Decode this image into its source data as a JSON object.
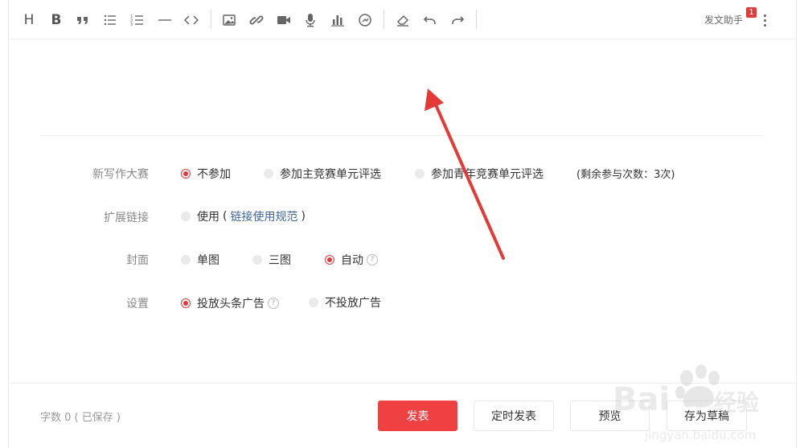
{
  "toolbar": {
    "buttons": [
      {
        "name": "heading-button",
        "text": "H"
      },
      {
        "name": "bold-button",
        "text": "B"
      },
      {
        "name": "quote-button",
        "icon": "quote-icon"
      },
      {
        "name": "bullet-list-button",
        "icon": "bullet-list-icon"
      },
      {
        "name": "numbered-list-button",
        "icon": "numbered-list-icon"
      },
      {
        "name": "horizontal-rule-button",
        "icon": "horizontal-rule-icon"
      },
      {
        "name": "code-button",
        "icon": "code-icon"
      },
      {
        "name": "image-button",
        "icon": "image-icon"
      },
      {
        "name": "link-button",
        "icon": "link-icon"
      },
      {
        "name": "video-button",
        "icon": "video-icon"
      },
      {
        "name": "audio-button",
        "icon": "microphone-icon"
      },
      {
        "name": "chart-button",
        "icon": "bar-chart-icon"
      },
      {
        "name": "vote-button",
        "icon": "circular-arrow-icon"
      },
      {
        "name": "clear-format-button",
        "icon": "eraser-icon"
      },
      {
        "name": "undo-button",
        "icon": "undo-icon"
      },
      {
        "name": "redo-button",
        "icon": "redo-icon"
      }
    ],
    "assistant_label": "发文助手",
    "assistant_badge": "1"
  },
  "settings": {
    "contest": {
      "label": "新写作大赛",
      "options": [
        "不参加",
        "参加主竞赛单元评选",
        "参加青年竞赛单元评选"
      ],
      "selected": 0,
      "remaining": "(剩余参与次数：3次)"
    },
    "extended_link": {
      "label": "扩展链接",
      "option": "使用",
      "paren_open": "(",
      "link_text": "链接使用规范",
      "paren_close": ")"
    },
    "cover": {
      "label": "封面",
      "options": [
        "单图",
        "三图",
        "自动"
      ],
      "selected": 2
    },
    "ads": {
      "label": "设置",
      "options": [
        "投放头条广告",
        "不投放广告"
      ],
      "selected": 0
    }
  },
  "footer": {
    "word_count": "字数 0 ( 已保存 )",
    "publish": "发表",
    "schedule": "定时发表",
    "preview": "预览",
    "save_draft": "存为草稿"
  },
  "colors": {
    "accent": "#f04142",
    "radio_selected": "#e2383c",
    "link": "#406599",
    "annotation_arrow": "#e53935"
  }
}
